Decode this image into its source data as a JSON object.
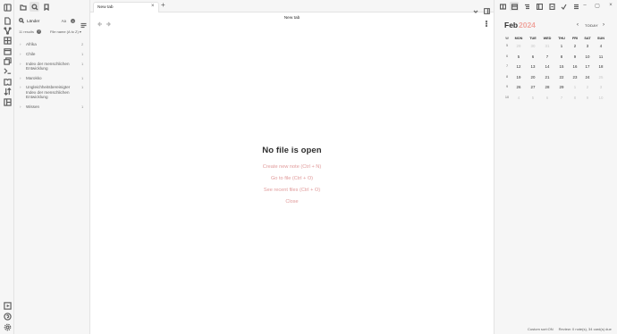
{
  "ribbon": {
    "icons": [
      "sidebar-toggle-icon",
      "file-explorer-icon",
      "graph-icon",
      "canvas-icon",
      "calendar-icon",
      "copy-icon",
      "template-icon",
      "terminal-icon",
      "book-icon",
      "sort-icon",
      "layout-icon",
      "vault-icon",
      "help-icon",
      "settings-icon"
    ]
  },
  "left_panel": {
    "tabs": [
      "folder-icon",
      "search-icon",
      "bookmark-icon"
    ],
    "search": {
      "value": "Länder",
      "match_case": "Aa"
    },
    "results_text": "11 results",
    "sort_label": "File name (A to Z)",
    "results": [
      {
        "label": "Afrika",
        "count": "2"
      },
      {
        "label": "Chile",
        "count": "1"
      },
      {
        "label": "Index der menschlichen Entwicklung",
        "count": "1"
      },
      {
        "label": "Marokko",
        "count": "1"
      },
      {
        "label": "Ungleichheitsbereinigter Index der menschlichen Entwicklung",
        "count": "1"
      },
      {
        "label": "Wissen",
        "count": "1"
      }
    ]
  },
  "main": {
    "tab_title": "New tab",
    "view_title": "New tab",
    "empty_title": "No file is open",
    "actions": [
      "Create new note (Ctrl + N)",
      "Go to file (Ctrl + O)",
      "See recent files (Ctrl + O)",
      "Close"
    ]
  },
  "calendar": {
    "month": "Feb",
    "year": "2024",
    "today_label": "TODAY",
    "weekdays": [
      "W",
      "MON",
      "TUE",
      "WED",
      "THU",
      "FRI",
      "SAT",
      "SUN"
    ],
    "weeks": [
      {
        "wk": "5",
        "days": [
          {
            "d": "29",
            "dim": true
          },
          {
            "d": "30",
            "dim": true
          },
          {
            "d": "31",
            "dim": true
          },
          {
            "d": "1"
          },
          {
            "d": "2"
          },
          {
            "d": "3"
          },
          {
            "d": "4"
          }
        ]
      },
      {
        "wk": "6",
        "days": [
          {
            "d": "5"
          },
          {
            "d": "6"
          },
          {
            "d": "7"
          },
          {
            "d": "8"
          },
          {
            "d": "9"
          },
          {
            "d": "10"
          },
          {
            "d": "11"
          }
        ]
      },
      {
        "wk": "7",
        "days": [
          {
            "d": "12"
          },
          {
            "d": "13"
          },
          {
            "d": "14"
          },
          {
            "d": "15"
          },
          {
            "d": "16"
          },
          {
            "d": "17"
          },
          {
            "d": "18"
          }
        ]
      },
      {
        "wk": "8",
        "days": [
          {
            "d": "19"
          },
          {
            "d": "20"
          },
          {
            "d": "21"
          },
          {
            "d": "22"
          },
          {
            "d": "23"
          },
          {
            "d": "24"
          },
          {
            "d": "25",
            "dim": true
          }
        ]
      },
      {
        "wk": "9",
        "days": [
          {
            "d": "26"
          },
          {
            "d": "27"
          },
          {
            "d": "28"
          },
          {
            "d": "29"
          },
          {
            "d": "1",
            "dim": true
          },
          {
            "d": "2",
            "dim": true
          },
          {
            "d": "3",
            "dim": true
          }
        ]
      },
      {
        "wk": "10",
        "days": [
          {
            "d": "4",
            "dim": true
          },
          {
            "d": "5",
            "dim": true
          },
          {
            "d": "6",
            "dim": true
          },
          {
            "d": "7",
            "dim": true
          },
          {
            "d": "8",
            "dim": true
          },
          {
            "d": "9",
            "dim": true
          },
          {
            "d": "10",
            "dim": true
          }
        ]
      }
    ]
  },
  "status": {
    "sort": "Custom sort:ON",
    "review": "Review: 0 note(s), 34 card(s) due"
  },
  "colors": {
    "accent": "#e09a9a",
    "year": "#f0a7a0",
    "panel_bg": "#f6f6f6"
  }
}
